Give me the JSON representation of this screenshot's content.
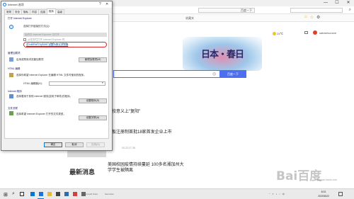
{
  "browser": {
    "url": "百度一下",
    "search_placeholder": "",
    "favorites_label": "收藏夹",
    "win_min": "—",
    "win_max": "☐",
    "win_close": "✕"
  },
  "page": {
    "weather_temp": "24℃",
    "user_name": "sabaresource",
    "doodle_text": "日本・春日",
    "search_button": "百度一下",
    "news": [
      {
        "text": "…校意义上\"复阳\""
      },
      {
        "text": "…板注册制首批18家首发企业上市"
      },
      {
        "text": "美国校园疫情持续蔓延 100多名湘加州大"
      },
      {
        "text": "学学生被隔离"
      }
    ],
    "news_meta": "00-22:27-38",
    "section_title": "最新消息",
    "watermark": "Bai百度",
    "watermark_sub": "jingyan.baidu.com"
  },
  "dialog": {
    "title": "Internet 选项",
    "help": "?",
    "close": "✕",
    "tabs": [
      "常规",
      "安全",
      "隐私",
      "内容",
      "连接",
      "程序",
      "高级"
    ],
    "ie_group": "打开 Internet Explorer",
    "ie_desc": "选择打开链接的方式(Q):",
    "ie_default": "始终在 Internet Explorer 中打开",
    "ie_check1": "从任务栏打开 Internet Explorer 时",
    "ie_check2": "在 Internet Explorer 桌面上打开链接",
    "ie_link": "将 Internet Explorer 设置为默认浏览器",
    "addons_group": "管理加载项",
    "addons_desc": "启用或禁用浏览器加载项",
    "addons_button": "管理加载项(M)",
    "html_group": "HTML 编辑",
    "html_desc": "选择你希望 Internet Explorer 在编辑 HTML 文件时使用的程序。",
    "html_label": "HTML 编辑器(H):",
    "html_select": "",
    "programs_group": "Internet 程序",
    "programs_desc": "选择要用于其他 Internet 服务(如电子邮件)的程序。",
    "programs_button": "设置程序(S)",
    "files_group": "文件关联",
    "files_desc": "选择希望 Internet Explorer 打开的文件类型。",
    "files_button": "设置关联(A)",
    "ok": "确定",
    "cancel": "取消",
    "apply": "应用(A)"
  },
  "taskbar": {
    "start": "⊞",
    "search": "⌕",
    "apps": [
      {
        "name": "mail",
        "color": "#0078d7",
        "open": false
      },
      {
        "name": "ie",
        "color": "#1d74d6",
        "open": true
      },
      {
        "name": "explorer",
        "color": "#e7b940",
        "open": false
      },
      {
        "name": "store",
        "color": "#444",
        "open": false
      },
      {
        "name": "photos",
        "color": "#2b6cb0",
        "open": false
      },
      {
        "name": "app6",
        "color": "#d04040",
        "open": false
      },
      {
        "name": "app7",
        "color": "#666",
        "open": false
      }
    ],
    "label1": "Microsoft Store",
    "label2": "Sens.Exe",
    "time": "8:31",
    "date": "2020/8/22",
    "tray": "^ ✦ ◖ ♪ 中"
  }
}
